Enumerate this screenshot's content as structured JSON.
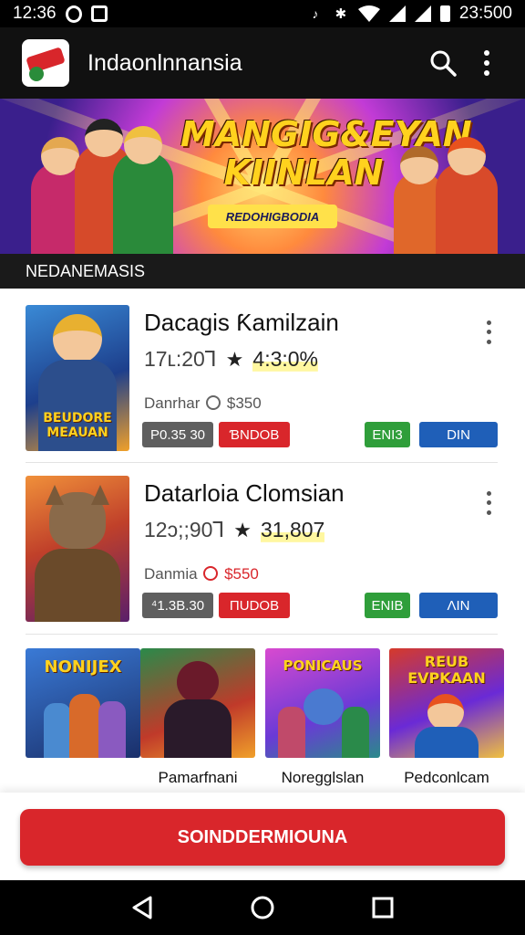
{
  "status_bar": {
    "time": "12:36",
    "right_text": "23:500"
  },
  "app_bar": {
    "title": "Indaonlnnansia",
    "icons": [
      "search-icon",
      "more-vert-icon"
    ]
  },
  "banner": {
    "title": "MANGIG&EYAN KIINLAN",
    "tag": "REDOHIGBODIA"
  },
  "section": {
    "label": "NEDANEMASIS"
  },
  "cards": [
    {
      "title": "Dacagis Ƙamilzain",
      "count": "17ʟ:20⅂",
      "rating": "4:3:0%",
      "meta_label": "Danrhar",
      "price": "$350",
      "thumb_text": "BEUDORE MEAUAN",
      "buttons": {
        "gray": "P0.35 30",
        "red": "ƁNDOB",
        "green": "ENI3",
        "blue": "DIN"
      }
    },
    {
      "title": "Datarloia Clomsian",
      "count": "12ɔ;;90⅂",
      "rating": "31,807",
      "meta_label": "Danmia",
      "price": "$550",
      "thumb_text": "",
      "buttons": {
        "gray": "⁴1.3B.30",
        "red": "ΠUDOB",
        "green": "ENIB",
        "blue": "ΛIN"
      }
    }
  ],
  "grid": [
    {
      "thumb_text": "NONIJEX",
      "label": ""
    },
    {
      "thumb_text": "",
      "label": "Pamarfnani"
    },
    {
      "thumb_text": "PONICAUS",
      "label": "Noregglslan"
    },
    {
      "thumb_text": "REUB EVPKAAN",
      "label": "Pedconlcam"
    }
  ],
  "cta": {
    "label": "SOINDDERMIOUNA"
  },
  "colors": {
    "accent_red": "#d9262b",
    "green": "#2f9e3a",
    "blue": "#1f5fb8",
    "dark": "#111111"
  }
}
